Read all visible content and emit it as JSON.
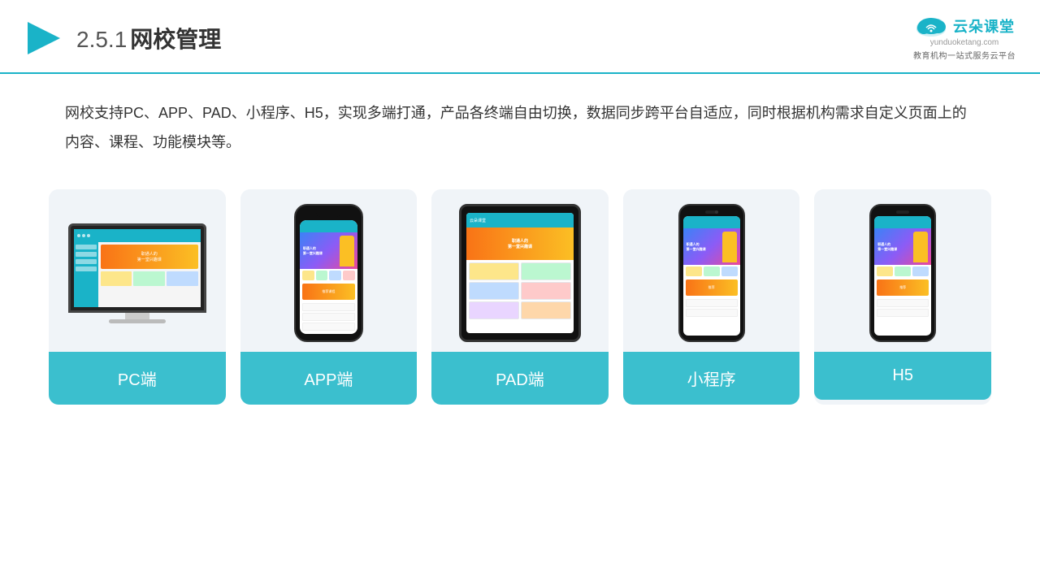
{
  "header": {
    "section": "2.5.1",
    "title": "网校管理",
    "logo_main": "云朵课堂",
    "logo_url": "yunduoketang.com",
    "logo_tagline": "教育机构一站式服务云平台"
  },
  "description": {
    "text": "网校支持PC、APP、PAD、小程序、H5，实现多端打通，产品各终端自由切换，数据同步跨平台自适应，同时根据机构需求自定义页面上的内容、课程、功能模块等。"
  },
  "cards": [
    {
      "id": "pc",
      "label": "PC端"
    },
    {
      "id": "app",
      "label": "APP端"
    },
    {
      "id": "pad",
      "label": "PAD端"
    },
    {
      "id": "miniprogram",
      "label": "小程序"
    },
    {
      "id": "h5",
      "label": "H5"
    }
  ],
  "colors": {
    "accent": "#1ab3c8",
    "card_label_bg": "#3bbfce",
    "header_border": "#1ab3c8"
  }
}
